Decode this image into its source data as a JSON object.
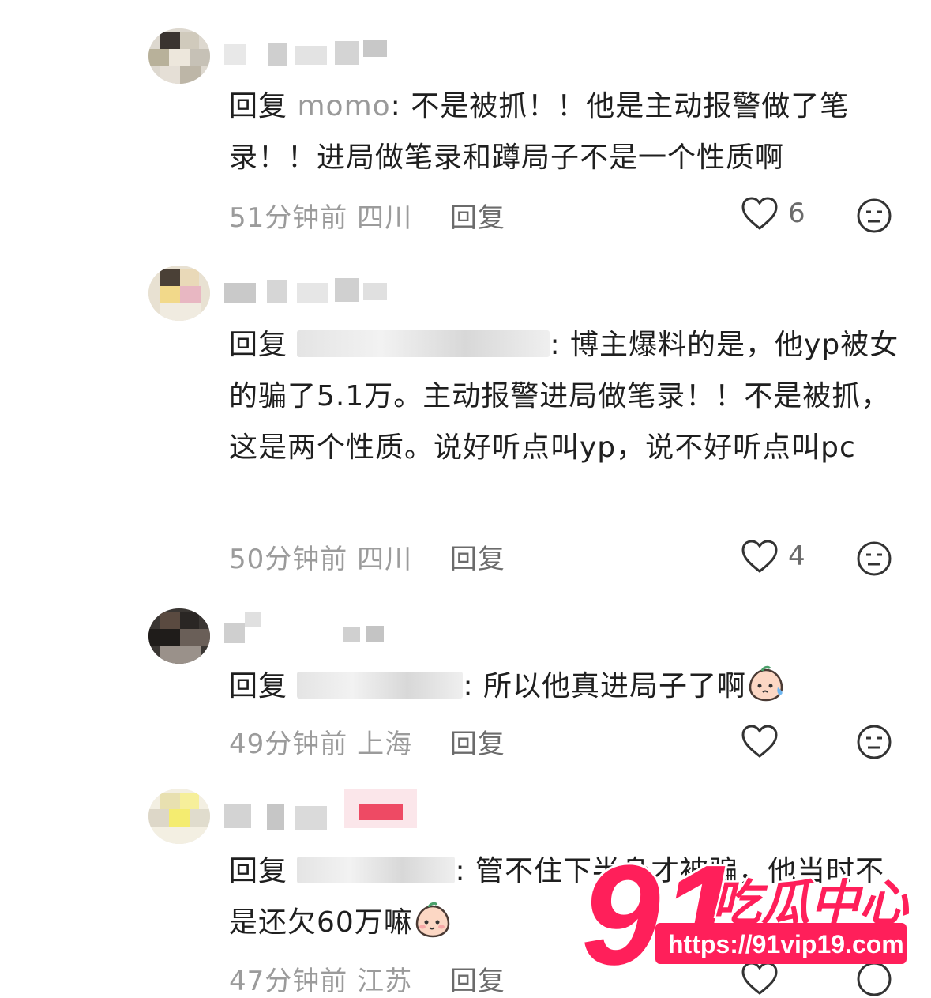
{
  "comments": [
    {
      "reply_word": "回复",
      "mention": "momo",
      "text": ": 不是被抓！！他是主动报警做了笔录！！进局做笔录和蹲局子不是一个性质啊",
      "time": "51分钟前",
      "location": "四川",
      "reply_label": "回复",
      "likes": "6"
    },
    {
      "reply_word": "回复",
      "mention": "",
      "text": ": 博主爆料的是，他yp被女的骗了5.1万。主动报警进局做笔录！！不是被抓，这是两个性质。说好听点叫yp，说不好听点叫pc",
      "time": "50分钟前",
      "location": "四川",
      "reply_label": "回复",
      "likes": "4"
    },
    {
      "reply_word": "回复",
      "mention": "",
      "text": ": 所以他真进局子了啊",
      "time": "49分钟前",
      "location": "上海",
      "reply_label": "回复",
      "likes": ""
    },
    {
      "reply_word": "回复",
      "mention": "",
      "text": ": 管不住下半身才被骗，他当时不是还欠60万嘛",
      "time": "47分钟前",
      "location": "江苏",
      "reply_label": "回复",
      "likes": ""
    }
  ],
  "watermark": {
    "logo_number": "91",
    "logo_text": "吃瓜中心",
    "url": "https://91vip19.com",
    "brand_color": "#ff1f5a"
  },
  "icons": {
    "like": "heart-outline-icon",
    "dislike": "unhappy-face-icon",
    "emoji_sweat": "sweating-peach-emoji",
    "emoji_peach": "peach-emoji"
  }
}
